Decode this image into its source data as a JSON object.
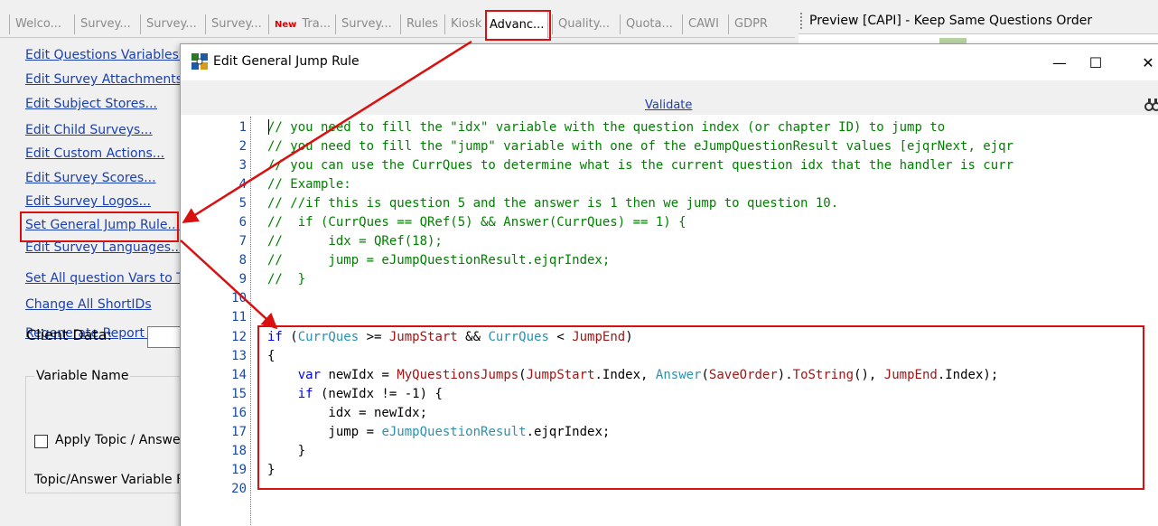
{
  "tabs": [
    {
      "label": "Welco...",
      "new": false,
      "active": false
    },
    {
      "label": "Survey...",
      "new": false,
      "active": false
    },
    {
      "label": "Survey...",
      "new": false,
      "active": false
    },
    {
      "label": "Survey...",
      "new": false,
      "active": false
    },
    {
      "label": "Tra...",
      "new": true,
      "new_label": "New",
      "active": false
    },
    {
      "label": "Survey...",
      "new": false,
      "active": false
    },
    {
      "label": "Rules",
      "new": false,
      "active": false
    },
    {
      "label": "Kiosk",
      "new": false,
      "active": false
    },
    {
      "label": "Advanc...",
      "new": false,
      "active": true
    },
    {
      "label": "Quality...",
      "new": false,
      "active": false
    },
    {
      "label": "Quota...",
      "new": false,
      "active": false
    },
    {
      "label": "CAWI",
      "new": false,
      "active": false
    },
    {
      "label": "GDPR",
      "new": false,
      "active": false
    }
  ],
  "preview": {
    "title": "Preview [CAPI] - Keep Same Questions Order"
  },
  "left_panel": {
    "links": [
      "Edit Questions Variables...",
      "Edit Survey Attachments...",
      "Edit Subject Stores...",
      "Edit Child Surveys...",
      "Edit Custom Actions...",
      "Edit Survey Scores...",
      "Edit Survey Logos...",
      "Set General Jump Rule...",
      "Edit Survey Languages...",
      "Set All question Vars to Te",
      "Change All ShortIDs",
      "Regenerate Report Index"
    ],
    "client_data_label": "Client Data:",
    "variable_name_label": "Variable Name",
    "apply_label": "Apply Topic / Answer",
    "topic_label": "Topic/Answer Variable Fo"
  },
  "dialog": {
    "title": "Edit General Jump Rule",
    "validate_label": "Validate",
    "minimize": "—",
    "maximize": "☐",
    "close": "✕"
  },
  "editor": {
    "line_numbers": [
      "1",
      "2",
      "3",
      "4",
      "5",
      "6",
      "7",
      "8",
      "9",
      "10",
      "11",
      "12",
      "13",
      "14",
      "15",
      "16",
      "17",
      "18",
      "19",
      "20"
    ],
    "lines": [
      [
        {
          "t": "// you need to fill the \"idx\" variable with the question index (or chapter ID) to jump to",
          "c": "cm"
        }
      ],
      [
        {
          "t": "// you need to fill the \"jump\" variable with one of the eJumpQuestionResult values [ejqrNext, ejqr",
          "c": "cm"
        }
      ],
      [
        {
          "t": "// you can use the CurrQues to determine what is the current question idx that the handler is curr",
          "c": "cm"
        }
      ],
      [
        {
          "t": "// Example:",
          "c": "cm"
        }
      ],
      [
        {
          "t": "// //if this is question 5 and the answer is 1 then we jump to question 10.",
          "c": "cm"
        }
      ],
      [
        {
          "t": "//  if (CurrQues == QRef(5) && Answer(CurrQues) == 1) {",
          "c": "cm"
        }
      ],
      [
        {
          "t": "//      idx = QRef(18);",
          "c": "cm"
        }
      ],
      [
        {
          "t": "//      jump = eJumpQuestionResult.ejqrIndex;",
          "c": "cm"
        }
      ],
      [
        {
          "t": "//  }",
          "c": "cm"
        }
      ],
      [],
      [],
      [
        {
          "t": "if",
          "c": "kw"
        },
        {
          "t": " (",
          "c": ""
        },
        {
          "t": "CurrQues",
          "c": "cls"
        },
        {
          "t": " >= ",
          "c": ""
        },
        {
          "t": "JumpStart",
          "c": "fn"
        },
        {
          "t": " && ",
          "c": ""
        },
        {
          "t": "CurrQues",
          "c": "cls"
        },
        {
          "t": " < ",
          "c": ""
        },
        {
          "t": "JumpEnd",
          "c": "fn"
        },
        {
          "t": ")",
          "c": ""
        }
      ],
      [
        {
          "t": "{",
          "c": ""
        }
      ],
      [
        {
          "t": "    ",
          "c": ""
        },
        {
          "t": "var",
          "c": "kw"
        },
        {
          "t": " newIdx = ",
          "c": ""
        },
        {
          "t": "MyQuestionsJumps",
          "c": "fn"
        },
        {
          "t": "(",
          "c": ""
        },
        {
          "t": "JumpStart",
          "c": "fn"
        },
        {
          "t": ".Index, ",
          "c": ""
        },
        {
          "t": "Answer",
          "c": "cls"
        },
        {
          "t": "(",
          "c": ""
        },
        {
          "t": "SaveOrder",
          "c": "fn"
        },
        {
          "t": ").",
          "c": ""
        },
        {
          "t": "ToString",
          "c": "fn"
        },
        {
          "t": "(), ",
          "c": ""
        },
        {
          "t": "JumpEnd",
          "c": "fn"
        },
        {
          "t": ".Index);",
          "c": ""
        }
      ],
      [
        {
          "t": "    ",
          "c": ""
        },
        {
          "t": "if",
          "c": "kw"
        },
        {
          "t": " (newIdx != -1) {",
          "c": ""
        }
      ],
      [
        {
          "t": "        idx = newIdx;",
          "c": ""
        }
      ],
      [
        {
          "t": "        jump = ",
          "c": ""
        },
        {
          "t": "eJumpQuestionResult",
          "c": "cls"
        },
        {
          "t": ".ejqrIndex;",
          "c": ""
        }
      ],
      [
        {
          "t": "    }",
          "c": ""
        }
      ],
      [
        {
          "t": "}",
          "c": ""
        }
      ],
      []
    ]
  },
  "colors": {
    "annotation": "#d81010",
    "link": "#1a3fb0",
    "comment": "#008000",
    "keyword": "#0000ff",
    "type": "#2b91af",
    "ident": "#a31515"
  }
}
